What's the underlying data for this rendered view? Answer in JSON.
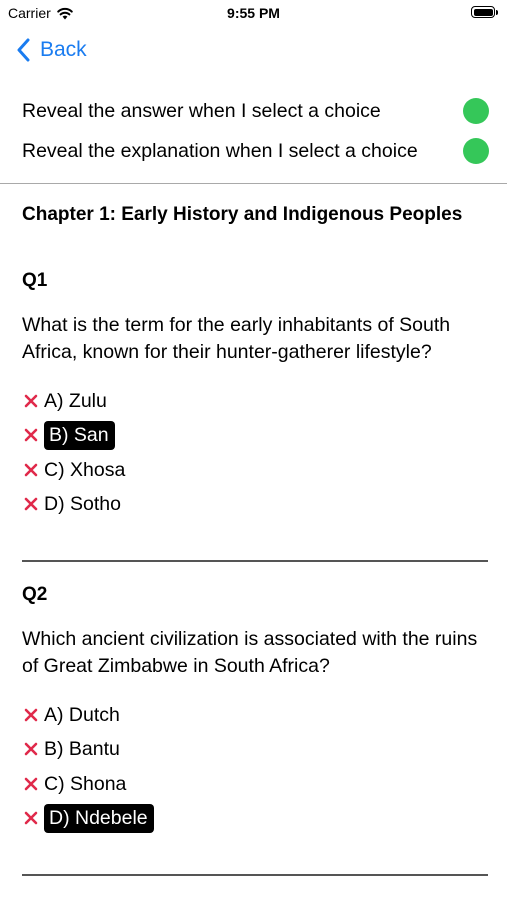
{
  "status_bar": {
    "carrier": "Carrier",
    "time": "9:55 PM"
  },
  "nav": {
    "back_label": "Back"
  },
  "settings": [
    {
      "label": "Reveal the answer when I select a choice",
      "enabled": true
    },
    {
      "label": "Reveal the explanation when I select a choice",
      "enabled": true
    }
  ],
  "colors": {
    "accent": "#1a7cf0",
    "toggle_on": "#35c759",
    "wrong_mark": "#e0294a"
  },
  "chapter_title": "Chapter 1: Early History and Indigenous Peoples",
  "questions": [
    {
      "label": "Q1",
      "text": "What is the term for the early inhabitants of South Africa, known for their hunter-gatherer lifestyle?",
      "choices": [
        {
          "text": "A) Zulu",
          "selected": false
        },
        {
          "text": "B) San",
          "selected": true
        },
        {
          "text": "C) Xhosa",
          "selected": false
        },
        {
          "text": "D) Sotho",
          "selected": false
        }
      ]
    },
    {
      "label": "Q2",
      "text": "Which ancient civilization is associated with the ruins of Great Zimbabwe in South Africa?",
      "choices": [
        {
          "text": "A) Dutch",
          "selected": false
        },
        {
          "text": "B) Bantu",
          "selected": false
        },
        {
          "text": "C) Shona",
          "selected": false
        },
        {
          "text": "D) Ndebele",
          "selected": true
        }
      ]
    }
  ]
}
